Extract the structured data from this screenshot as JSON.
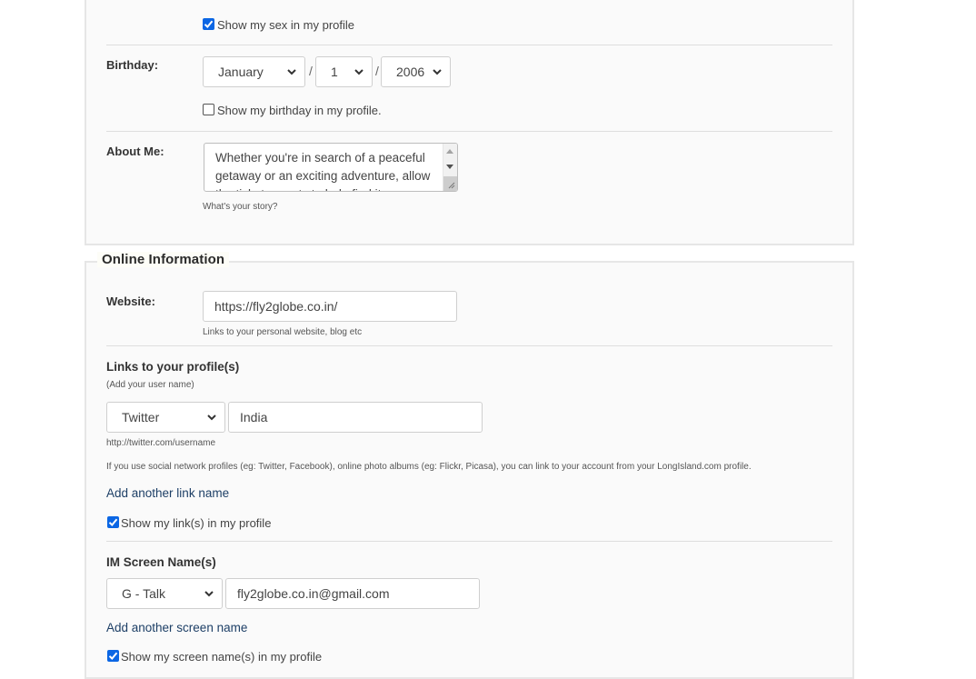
{
  "personal": {
    "show_sex_label": "Show my sex in my profile",
    "show_sex_checked": true,
    "birthday_label": "Birthday:",
    "birthday_month": "January",
    "birthday_day": "1",
    "birthday_year": "2006",
    "date_separator": "/",
    "show_birthday_label": "Show my birthday in my profile.",
    "show_birthday_checked": false,
    "about_label": "About Me:",
    "about_value": "Whether you're in search of a peaceful getaway or an exciting adventure, allow the ticket experts to help find it.",
    "about_hint": "What's your story?"
  },
  "online": {
    "legend": "Online Information",
    "website_label": "Website:",
    "website_value": "https://fly2globe.co.in/",
    "website_hint": "Links to your personal website, blog etc",
    "links_heading": "Links to your profile(s)",
    "links_subheading": "(Add your user name)",
    "link_service": "Twitter",
    "link_username": "India",
    "link_url_hint": "http://twitter.com/username",
    "links_info": "If you use social network profiles (eg: Twitter, Facebook), online photo albums (eg: Flickr, Picasa), you can link to your account from your LongIsland.com profile.",
    "add_link_label": "Add another link name",
    "show_links_label": "Show my link(s) in my profile",
    "show_links_checked": true,
    "im_heading": "IM Screen Name(s)",
    "im_service": "G - Talk",
    "im_value": "fly2globe.co.in@gmail.com",
    "add_screen_name_label": "Add another screen name",
    "show_screen_names_label": "Show my screen name(s) in my profile",
    "show_screen_names_checked": true
  },
  "colors": {
    "checkbox_accent": "#0b66e4",
    "link_text": "#1d3f66",
    "panel_background": "#fafafa",
    "panel_border": "#e6e6e6"
  }
}
